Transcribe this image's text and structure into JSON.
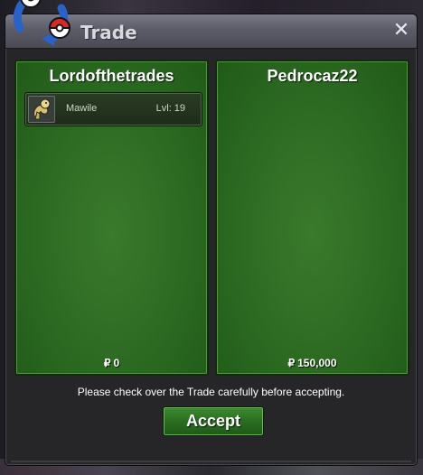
{
  "window": {
    "title": "Trade",
    "close_glyph": "✕"
  },
  "logo": {
    "icon": "trade-arrows-pokeballs-icon"
  },
  "left_panel": {
    "owner": "Lordofthetrades",
    "items": [
      {
        "name": "Mawile",
        "level": "Lvl: 19",
        "icon": "mawile-sprite-icon"
      }
    ],
    "currency_symbol": "₽",
    "money": "0"
  },
  "right_panel": {
    "owner": "Pedrocaz22",
    "items": [],
    "currency_symbol": "₽",
    "money": "150,000"
  },
  "notice": "Please check over the Trade carefully before accepting.",
  "accept_label": "Accept",
  "colors": {
    "panel_green": "#2c6a22",
    "button_green": "#2a6a20",
    "titlebar": "#5c5c68"
  }
}
